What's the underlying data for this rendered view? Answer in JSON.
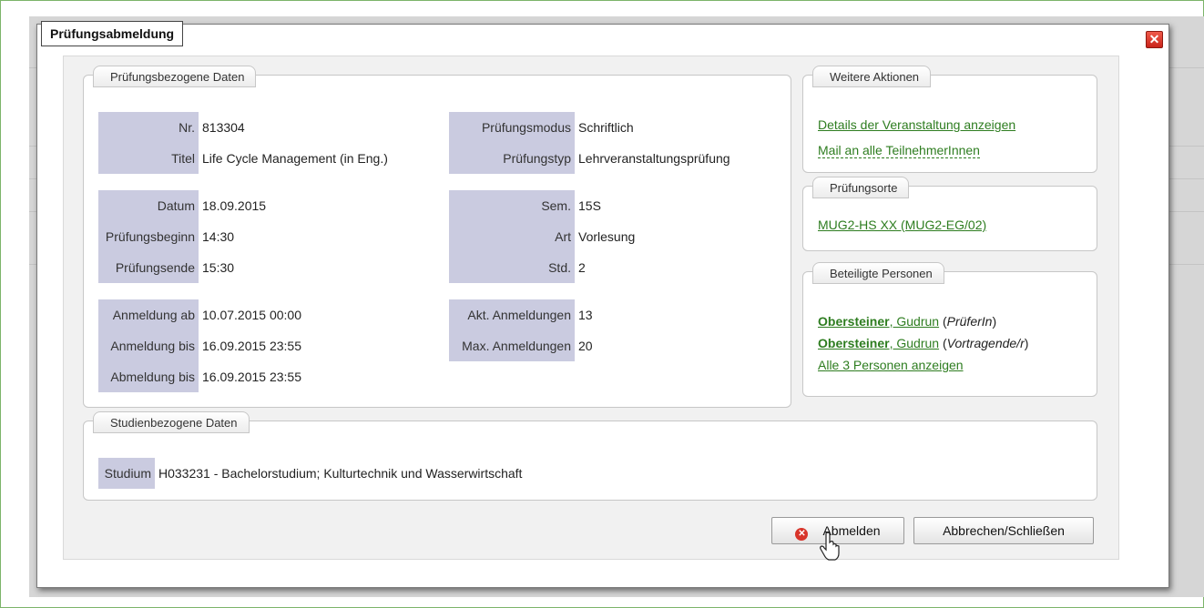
{
  "dialog": {
    "title": "Prüfungsabmeldung",
    "close_symbol": "✕"
  },
  "exam": {
    "legend": "Prüfungsbezogene Daten",
    "fields": {
      "nr": {
        "label": "Nr.",
        "value": "813304"
      },
      "titel": {
        "label": "Titel",
        "value": "Life Cycle Management (in Eng.)"
      },
      "modus": {
        "label": "Prüfungsmodus",
        "value": "Schriftlich"
      },
      "typ": {
        "label": "Prüfungstyp",
        "value": "Lehrveranstaltungsprüfung"
      },
      "datum": {
        "label": "Datum",
        "value": "18.09.2015"
      },
      "beginn": {
        "label": "Prüfungsbeginn",
        "value": "14:30"
      },
      "ende": {
        "label": "Prüfungsende",
        "value": "15:30"
      },
      "sem": {
        "label": "Sem.",
        "value": "15S"
      },
      "art": {
        "label": "Art",
        "value": "Vorlesung"
      },
      "std": {
        "label": "Std.",
        "value": "2"
      },
      "anmeldung_ab": {
        "label": "Anmeldung ab",
        "value": "10.07.2015 00:00"
      },
      "anmeldung_bis": {
        "label": "Anmeldung bis",
        "value": "16.09.2015 23:55"
      },
      "abmeldung_bis": {
        "label": "Abmeldung bis",
        "value": "16.09.2015 23:55"
      },
      "akt_anmeldungen": {
        "label": "Akt. Anmeldungen",
        "value": "13"
      },
      "max_anmeldungen": {
        "label": "Max. Anmeldungen",
        "value": "20"
      }
    }
  },
  "actions": {
    "legend": "Weitere Aktionen",
    "details": "Details der Veranstaltung anzeigen",
    "mail": "Mail an alle TeilnehmerInnen"
  },
  "orte": {
    "legend": "Prüfungsorte",
    "room": "MUG2-HS XX (MUG2-EG/02)"
  },
  "personen": {
    "legend": "Beteiligte Personen",
    "people": [
      {
        "surname": "Obersteiner",
        "firstname": ", Gudrun",
        "role": "PrüferIn"
      },
      {
        "surname": "Obersteiner",
        "firstname": ", Gudrun",
        "role": "Vortragende/r"
      }
    ],
    "show_all": "Alle 3 Personen anzeigen"
  },
  "studium": {
    "legend": "Studienbezogene Daten",
    "label": "Studium",
    "value": "H033231 - Bachelorstudium; Kulturtechnik und Wasserwirtschaft"
  },
  "buttons": {
    "abmelden": "Abmelden",
    "abbrechen": "Abbrechen/Schließen"
  },
  "colors": {
    "label_bg": "#cacbe0",
    "link": "#2e7d20",
    "close_red": "#d8342a"
  },
  "icons": [
    "close-icon",
    "cancel-x-icon",
    "hand-cursor-icon"
  ]
}
